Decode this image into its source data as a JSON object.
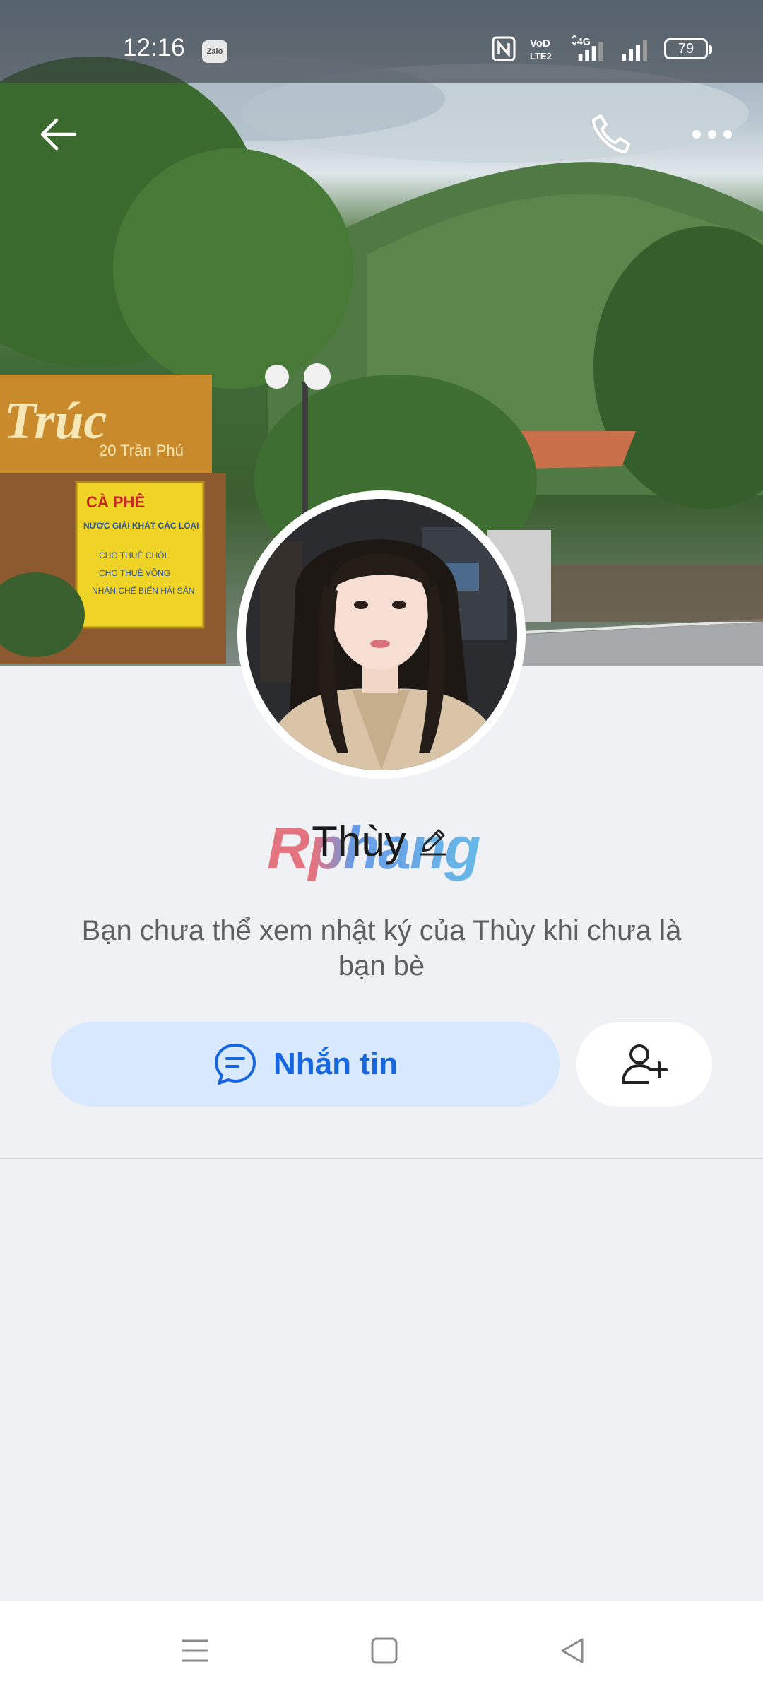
{
  "status_bar": {
    "time": "12:16",
    "notification_app": "Zalo",
    "network_label": "4G",
    "volte_label": "VoLTE",
    "battery_level": "79",
    "icons": [
      "zalo-icon",
      "nfc-icon",
      "volte-icon",
      "signal-icon",
      "battery-icon"
    ]
  },
  "header": {
    "back_icon": "arrow-left-icon",
    "call_icon": "phone-icon",
    "more_icon": "more-dots-icon"
  },
  "cover": {
    "sign_text": "Trúc",
    "sign_address": "20 Trần Phú",
    "sign_board_lines": [
      "CÀ PHÊ",
      "NƯỚC GIẢI KHÁT CÁC LOẠI",
      "CHO THUÊ CHÒI",
      "CHO THUÊ VÕNG",
      "NHẬN CHẾ BIẾN HẢI SẢN"
    ]
  },
  "profile": {
    "name": "Thùy",
    "watermark": "Rphang",
    "edit_icon": "pencil-icon",
    "info_text": "Bạn chưa thể xem nhật ký của Thùy khi chưa là bạn bè"
  },
  "actions": {
    "message_label": "Nhắn tin",
    "message_icon": "chat-bubble-icon",
    "add_friend_icon": "add-user-icon",
    "accent_color": "#1666e0"
  },
  "navigation": {
    "icons": [
      "menu-icon",
      "home-square-icon",
      "back-triangle-icon"
    ]
  }
}
